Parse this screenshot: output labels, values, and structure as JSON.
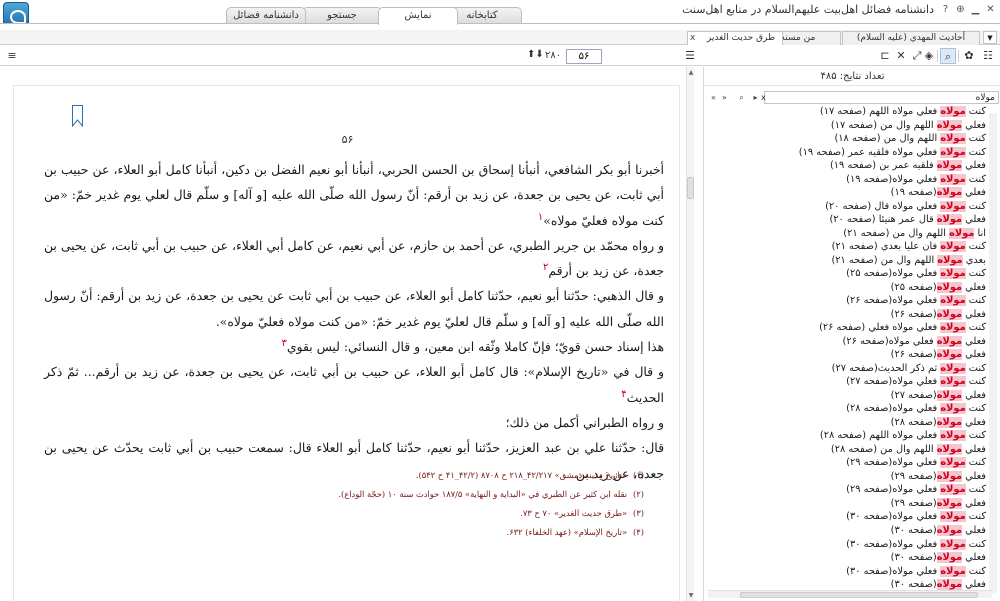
{
  "window": {
    "title": "دانشنامه فضائل اهل‌بیت علیهم‌السلام در منابع اهل‌سنت",
    "help_label": "?",
    "pin_label": "⊕",
    "minimize_label": "▁",
    "close_label": "✕"
  },
  "main_tabs": [
    {
      "label": "کتابخانه",
      "active": false
    },
    {
      "label": "نمایش",
      "active": true
    },
    {
      "label": "جستجو",
      "active": false
    },
    {
      "label": "دانشنامه فضائل",
      "active": false
    }
  ],
  "doc_tabs": [
    {
      "label": "طرق حديث الغدير",
      "active": true,
      "close_label": "x"
    },
    {
      "label": "من مسند أحمد بن حنبل",
      "active": false
    },
    {
      "label": "أحاديث المهدي (عليه السلام)",
      "active": false
    }
  ],
  "doc_tabs_more_label": "▼",
  "toolbar": {
    "page_current": "۵۶",
    "page_total": "۲۸۰",
    "stepper_label": "⬆⬇",
    "icons": [
      "list-icon",
      "settings-gear-icon",
      "search-icon",
      "eraser-icon",
      "fit-page-icon",
      "expand-icon",
      "bookmark-icon",
      "lines-icon"
    ]
  },
  "document": {
    "page_number": "۵۶",
    "paragraphs": [
      {
        "text": "أخبرنا أبو بكر الشافعي، أنبأنا إسحاق بن الحسن الحربي، أنبأنا أبو نعيم الفضل بن دكين، أنبأنا كامل أبو العلاء، عن حبيب بن أبي ثابت، عن يحيى بن جعدة، عن زيد بن أرقم: أنّ رسول الله صلّى الله عليه [و آله] و سلّم قال لعلي يوم غدير خمّ: «من كنت مولاه فعليّ مولاه»",
        "ref": "۱"
      },
      {
        "text": "و رواه محمّد بن جرير الطبري، عن أحمد بن حازم، عن أبي نعيم، عن كامل أبي العلاء، عن حبيب بن أبي ثابت، عن يحيى بن جعدة، عن زيد بن أرقم",
        "ref": "۲"
      },
      {
        "text": "و قال الذهبي: حدّثنا أبو نعيم، حدّثنا كامل أبو العلاء، عن حبيب بن أبي ثابت عن يحيى بن جعدة، عن زيد بن أرقم: أنّ رسول الله صلّى الله عليه [و آله] و سلّم قال لعليّ يوم غدير خمّ: «من كنت مولاه فعليّ مولاه».",
        "ref": ""
      },
      {
        "text": "هذا إسناد حسن قويّ؛ فإنّ كاملا وثّقه ابن معين، و قال النسائي: ليس بقوي",
        "ref": "۳"
      },
      {
        "text": "و قال في «تاريخ الإسلام»: قال كامل أبو العلاء، عن حبيب بن أبي ثابت، عن يحيى بن جعدة، عن زيد بن أرقم... ثمّ ذكر الحديث",
        "ref": "۴"
      },
      {
        "text": "و رواه الطبراني أكمل من ذلك؛",
        "ref": ""
      },
      {
        "text": "قال: حدّثنا علي بن عبد العزيز، حدّثنا أبو نعيم، حدّثنا كامل أبو العلاء قال: سمعت حبيب بن أبي ثابت يحدّث عن يحيى بن جعدة، عن زيد بن",
        "ref": ""
      }
    ],
    "footnotes": [
      {
        "num": "(۱)",
        "text": "«تاريخ مدينة دمشق» ۴۲/۲۱۷_۲۱۸ ح ۸۷۰۸ (۴۲/۲_۴۱ ح ۵۴۲)."
      },
      {
        "num": "(۲)",
        "text": "نقله ابن كثير عن الطبري في «البداية و النهاية» ۱۸۷/۵ حوادث سنة ۱۰ (حجّة الوداع)."
      },
      {
        "num": "(۳)",
        "text": "«طرق حديث الغدير» ۷۰ ح ۷۳."
      },
      {
        "num": "(۴)",
        "text": "«تاريخ الإسلام» (عهد الخلفاء) ۶۳۲."
      }
    ]
  },
  "results_panel": {
    "count_label": "تعداد نتایج: ۴۸۵",
    "search_value": "مولاه",
    "search_clear_label": "x",
    "search_go_label": "⌕",
    "search_prev_label": "«",
    "search_next_label": "»",
    "items": [
      {
        "pre": "كنت ",
        "hl": "مولاه",
        "post": " فعلي مولاه اللهم (صفحه ۱۷)"
      },
      {
        "pre": "فعلي ",
        "hl": "مولاه",
        "post": " اللهم وال من (صفحه ۱۷)"
      },
      {
        "pre": "كنت ",
        "hl": "مولاه",
        "post": " اللهم وال من (صفحه ۱۸)"
      },
      {
        "pre": "كنت ",
        "hl": "مولاه",
        "post": " فعلي مولاه فلقيه عمر (صفحه ۱۹)"
      },
      {
        "pre": "فعلي ",
        "hl": "مولاه",
        "post": " فلقيه عمر بن (صفحه ۱۹)"
      },
      {
        "pre": "كنت ",
        "hl": "مولاه",
        "post": " فعلي مولاه(صفحه ۱۹)"
      },
      {
        "pre": "فعلي ",
        "hl": "مولاه",
        "post": "(صفحه ۱۹)"
      },
      {
        "pre": "كنت ",
        "hl": "مولاه",
        "post": " فعلي مولاه قال (صفحه ۲۰)"
      },
      {
        "pre": "فعلي ",
        "hl": "مولاه",
        "post": " قال عمر هنيئا (صفحه ۲۰)"
      },
      {
        "pre": "انا ",
        "hl": "مولاه",
        "post": " اللهم وال من (صفحه ۲۱)"
      },
      {
        "pre": "كنت ",
        "hl": "مولاه",
        "post": " فان عليا بعدي (صفحه ۲۱)"
      },
      {
        "pre": "بعدي ",
        "hl": "مولاه",
        "post": " اللهم وال من (صفحه ۲۱)"
      },
      {
        "pre": "كنت ",
        "hl": "مولاه",
        "post": " فعلي مولاه(صفحه ۲۵)"
      },
      {
        "pre": "فعلي ",
        "hl": "مولاه",
        "post": "(صفحه ۲۵)"
      },
      {
        "pre": "كنت ",
        "hl": "مولاه",
        "post": " فعلي مولاه(صفحه ۲۶)"
      },
      {
        "pre": "فعلي ",
        "hl": "مولاه",
        "post": "(صفحه ۲۶)"
      },
      {
        "pre": "كنت ",
        "hl": "مولاه",
        "post": " فعلي مولاه فعلي (صفحه ۲۶)"
      },
      {
        "pre": "فعلي ",
        "hl": "مولاه",
        "post": " فعلي مولاه(صفحه ۲۶)"
      },
      {
        "pre": "فعلي ",
        "hl": "مولاه",
        "post": "(صفحه ۲۶)"
      },
      {
        "pre": "كنت ",
        "hl": "مولاه",
        "post": " ثم ذكر الحديث(صفحه ۲۷)"
      },
      {
        "pre": "كنت ",
        "hl": "مولاه",
        "post": " فعلي مولاه(صفحه ۲۷)"
      },
      {
        "pre": "فعلي ",
        "hl": "مولاه",
        "post": "(صفحه ۲۷)"
      },
      {
        "pre": "كنت ",
        "hl": "مولاه",
        "post": " فعلي مولاه(صفحه ۲۸)"
      },
      {
        "pre": "فعلي ",
        "hl": "مولاه",
        "post": "(صفحه ۲۸)"
      },
      {
        "pre": "كنت ",
        "hl": "مولاه",
        "post": " فعلي مولاه اللهم (صفحه ۲۸)"
      },
      {
        "pre": "فعلي ",
        "hl": "مولاه",
        "post": " اللهم وال من (صفحه ۲۸)"
      },
      {
        "pre": "كنت ",
        "hl": "مولاه",
        "post": " فعلي مولاه(صفحه ۲۹)"
      },
      {
        "pre": "فعلي ",
        "hl": "مولاه",
        "post": "(صفحه ۲۹)"
      },
      {
        "pre": "كنت ",
        "hl": "مولاه",
        "post": " فعلي مولاه(صفحه ۲۹)"
      },
      {
        "pre": "فعلي ",
        "hl": "مولاه",
        "post": "(صفحه ۲۹)"
      },
      {
        "pre": "كنت ",
        "hl": "مولاه",
        "post": " فعلي مولاه(صفحه ۳۰)"
      },
      {
        "pre": "فعلي ",
        "hl": "مولاه",
        "post": "(صفحه ۳۰)"
      },
      {
        "pre": "كنت ",
        "hl": "مولاه",
        "post": " فعلي مولاه(صفحه ۳۰)"
      },
      {
        "pre": "فعلي ",
        "hl": "مولاه",
        "post": "(صفحه ۳۰)"
      },
      {
        "pre": "كنت ",
        "hl": "مولاه",
        "post": " فعلي مولاه(صفحه ۳۰)"
      },
      {
        "pre": "فعلي ",
        "hl": "مولاه",
        "post": "(صفحه ۳۰)"
      }
    ]
  },
  "colors": {
    "accent": "#1d6ea6",
    "highlight_bg": "#f4c6cf",
    "highlight_text": "#d0001a",
    "footnote_text": "#7a1a1a",
    "reference_mark": "#c4001a"
  }
}
